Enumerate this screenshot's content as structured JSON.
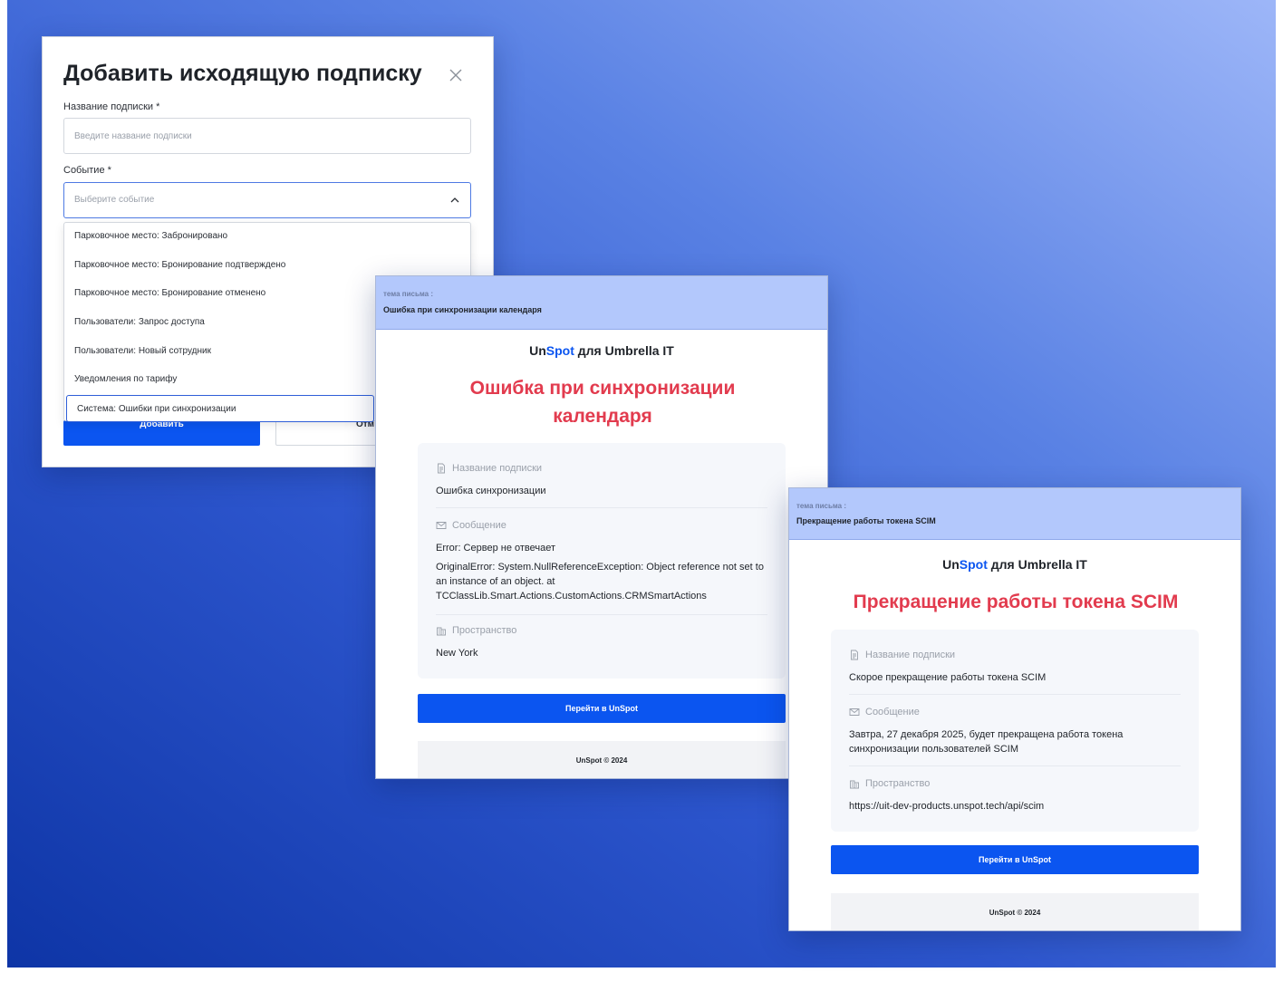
{
  "dialog": {
    "title": "Добавить исходящую подписку",
    "name_label": "Название подписки *",
    "name_placeholder": "Введите название подписки",
    "event_label": "Событие *",
    "event_placeholder": "Выберите событие",
    "options": [
      "Парковочное место: Забронировано",
      "Парковочное место: Бронирование подтверждено",
      "Парковочное место: Бронирование отменено",
      "Пользователи: Запрос доступа",
      "Пользователи: Новый сотрудник",
      "Уведомления по тарифу",
      "Система: Ошибки при синхронизации"
    ],
    "selected_option_index": 6,
    "add_button": "Добавить",
    "cancel_button": "Отм"
  },
  "email_calendar": {
    "subject_caption": "тема письма :",
    "subject": "Ошибка при синхронизации календаря",
    "brand_un": "Un",
    "brand_spot": "Spot",
    "brand_rest": " для Umbrella IT",
    "title": "Ошибка при синхронизации календаря",
    "name_label": "Название подписки",
    "name_value": "Ошибка синхронизации",
    "message_label": "Сообщение",
    "message_line1": "Error: Сервер не отвечает",
    "message_line2": "OriginalError: System.NullReferenceException: Object reference not set to an instance of an object. at TCClassLib.Smart.Actions.CustomActions.CRMSmartActions",
    "space_label": "Пространство",
    "space_value": "New York",
    "cta": "Перейти в UnSpot",
    "footer": "UnSpot © 2024"
  },
  "email_scim": {
    "subject_caption": "тема письма :",
    "subject": "Прекращение работы токена SCIM",
    "brand_un": "Un",
    "brand_spot": "Spot",
    "brand_rest": " для Umbrella IT",
    "title": "Прекращение работы токена SCIM",
    "name_label": "Название подписки",
    "name_value": "Скорое прекращение работы токена SCIM",
    "message_label": "Сообщение",
    "message_value": "Завтра, 27 декабря 2025, будет прекращена работа токена синхронизации пользователей SCIM",
    "space_label": "Пространство",
    "space_value": "https://uit-dev-products.unspot.tech/api/scim",
    "cta": "Перейти в UnSpot",
    "footer": "UnSpot © 2024"
  }
}
